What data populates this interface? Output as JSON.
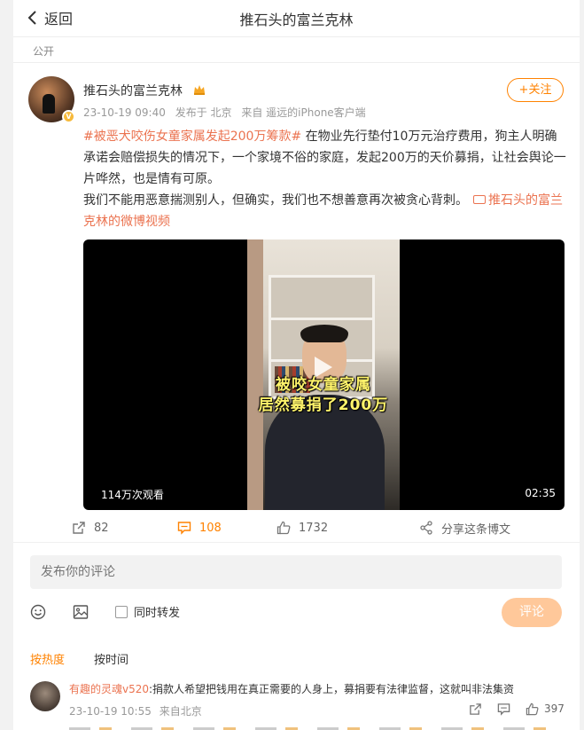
{
  "header": {
    "back_label": "返回",
    "title": "推石头的富兰克林"
  },
  "visibility": "公开",
  "post": {
    "author": "推石头的富兰克林",
    "time": "23-10-19 09:40",
    "location": "发布于 北京",
    "source": "来自 遥远的iPhone客户端",
    "follow_label": "+关注",
    "hashtag": "#被恶犬咬伤女童家属发起200万筹款#",
    "text_line1_rest": " 在物业先行垫付10万元治疗费用，狗主人明确承诺会赔偿损失的情况下，一个家境不俗的家庭，发起200万的天价募捐，让社会舆论一片哗然，也是情有可原。",
    "text_para2": "我们不能用恶意揣测别人，但确实，我们也不想善意再次被贪心背刺。",
    "video_link": "推石头的富兰克林的微博视频",
    "video": {
      "caption_line1": "被咬女童家属",
      "caption_line2": "居然募捐了200万",
      "views": "114万次观看",
      "duration": "02:35"
    },
    "actions": {
      "repost_count": "82",
      "comment_count": "108",
      "like_count": "1732",
      "share_label": "分享这条博文"
    }
  },
  "comment_box": {
    "placeholder": "发布你的评论",
    "repost_label": "同时转发",
    "submit_label": "评论"
  },
  "sort_tabs": {
    "hot": "按热度",
    "time": "按时间"
  },
  "comments": [
    {
      "user": "有趣的灵魂v520",
      "text": ":捐款人希望把钱用在真正需要的人身上，募捐要有法律监督，这就叫非法集资",
      "time": "23-10-19 10:55",
      "location": "来自北京",
      "likes": "397"
    }
  ],
  "colors": {
    "accent": "#ff8200",
    "link": "#eb7350"
  }
}
